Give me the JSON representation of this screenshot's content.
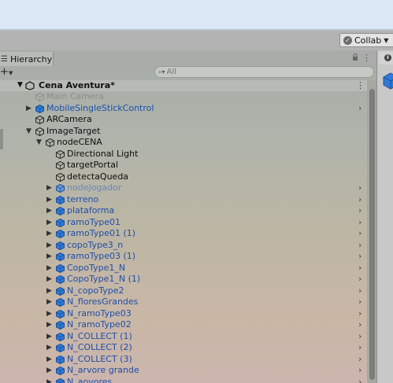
{
  "toolbar": {
    "collab_label": "Collab"
  },
  "hierarchy": {
    "tab_label": "Hierarchy",
    "search_placeholder": "All",
    "scene": {
      "name": "Cena Aventura*"
    },
    "items": [
      {
        "label": "Main Camera",
        "indent": 0,
        "arrow": false,
        "cube": "outline",
        "color": "#8a8f8a",
        "chevron": false
      },
      {
        "label": "MobileSingleStickControl",
        "indent": 0,
        "arrow": true,
        "cube": "blue",
        "color": "#1f4ea8",
        "chevron": true
      },
      {
        "label": "ARCamera",
        "indent": 0,
        "arrow": false,
        "cube": "outline",
        "color": "#0d0d0d",
        "chevron": false
      },
      {
        "label": "ImageTarget",
        "indent": 0,
        "arrow": true,
        "expanded": true,
        "cube": "outline",
        "color": "#0d0d0d",
        "chevron": false
      },
      {
        "label": "nodeCENA",
        "indent": 1,
        "arrow": true,
        "expanded": true,
        "cube": "outline",
        "color": "#0d0d0d",
        "chevron": false
      },
      {
        "label": "Directional Light",
        "indent": 2,
        "arrow": false,
        "cube": "outline",
        "color": "#0d0d0d",
        "chevron": false
      },
      {
        "label": "targetPortal",
        "indent": 2,
        "arrow": false,
        "cube": "outline",
        "color": "#0d0d0d",
        "chevron": false
      },
      {
        "label": "detectaQueda",
        "indent": 2,
        "arrow": false,
        "cube": "outline",
        "color": "#0d0d0d",
        "chevron": false
      },
      {
        "label": "nodeJogador",
        "indent": 2,
        "arrow": true,
        "cube": "blue-faded",
        "color": "#6f86b4",
        "chevron": true
      },
      {
        "label": "terreno",
        "indent": 2,
        "arrow": true,
        "cube": "blue",
        "color": "#1f4ea8",
        "chevron": true
      },
      {
        "label": "plataforma",
        "indent": 2,
        "arrow": true,
        "cube": "blue",
        "color": "#1f4ea8",
        "chevron": true
      },
      {
        "label": "ramoType01",
        "indent": 2,
        "arrow": true,
        "cube": "blue",
        "color": "#1f4ea8",
        "chevron": true
      },
      {
        "label": "ramoType01 (1)",
        "indent": 2,
        "arrow": true,
        "cube": "blue",
        "color": "#1f4ea8",
        "chevron": true
      },
      {
        "label": "copoType3_n",
        "indent": 2,
        "arrow": true,
        "cube": "blue",
        "color": "#1f4ea8",
        "chevron": true
      },
      {
        "label": "ramoType03 (1)",
        "indent": 2,
        "arrow": true,
        "cube": "blue",
        "color": "#1f4ea8",
        "chevron": true
      },
      {
        "label": "CopoType1_N",
        "indent": 2,
        "arrow": true,
        "cube": "blue",
        "color": "#1f4ea8",
        "chevron": true
      },
      {
        "label": "CopoType1_N (1)",
        "indent": 2,
        "arrow": true,
        "cube": "blue",
        "color": "#1f4ea8",
        "chevron": true
      },
      {
        "label": "N_copoType2",
        "indent": 2,
        "arrow": true,
        "cube": "blue",
        "color": "#1f4ea8",
        "chevron": true
      },
      {
        "label": "N_floresGrandes",
        "indent": 2,
        "arrow": true,
        "cube": "blue",
        "color": "#1f4ea8",
        "chevron": true
      },
      {
        "label": "N_ramoType03",
        "indent": 2,
        "arrow": true,
        "cube": "blue",
        "color": "#1f4ea8",
        "chevron": true
      },
      {
        "label": "N_ramoType02",
        "indent": 2,
        "arrow": true,
        "cube": "blue",
        "color": "#1f4ea8",
        "chevron": true
      },
      {
        "label": "N_COLLECT (1)",
        "indent": 2,
        "arrow": true,
        "cube": "blue",
        "color": "#1f4ea8",
        "chevron": true
      },
      {
        "label": "N_COLLECT (2)",
        "indent": 2,
        "arrow": true,
        "cube": "blue",
        "color": "#1f4ea8",
        "chevron": true
      },
      {
        "label": "N_COLLECT (3)",
        "indent": 2,
        "arrow": true,
        "cube": "blue",
        "color": "#1f4ea8",
        "chevron": true
      },
      {
        "label": "N_arvore grande",
        "indent": 2,
        "arrow": true,
        "cube": "blue",
        "color": "#1f4ea8",
        "chevron": true
      },
      {
        "label": "N_aovores",
        "indent": 2,
        "arrow": true,
        "cube": "blue",
        "color": "#1f4ea8",
        "chevron": true
      }
    ]
  },
  "colors": {
    "prefab_blue": "#1f4ea8",
    "accent_blue": "#2f7ad9"
  }
}
